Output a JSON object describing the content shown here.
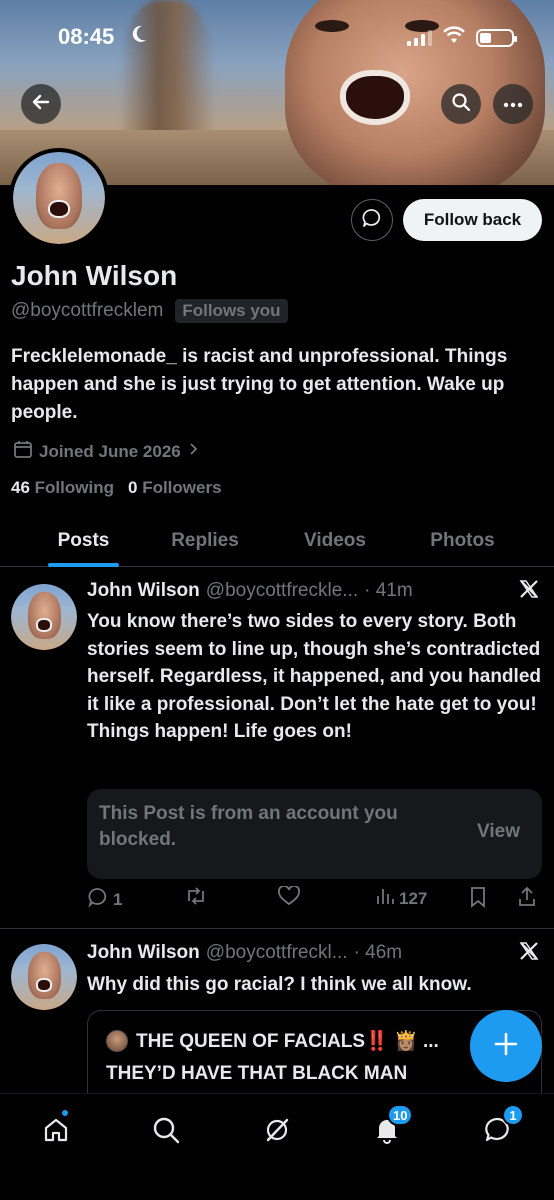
{
  "status_bar": {
    "time": "08:45"
  },
  "profile": {
    "name": "John Wilson",
    "handle": "@boycottfrecklem",
    "follows_you": "Follows you",
    "bio": "Frecklelemonade_ is racist and unprofessional. Things happen and she is just trying to get attention. Wake up people.",
    "joined": "Joined June 2026",
    "following_count": "46",
    "following_label": "Following",
    "followers_count": "0",
    "followers_label": "Followers",
    "follow_button": "Follow back"
  },
  "tabs": [
    {
      "label": "Posts",
      "active": true
    },
    {
      "label": "Replies"
    },
    {
      "label": "Videos"
    },
    {
      "label": "Photos"
    }
  ],
  "posts": [
    {
      "author": "John Wilson",
      "handle": "@boycottfreckle...",
      "time": "· 41m",
      "text": "You know there’s two sides to every story. Both stories seem to line up, though she’s contradicted herself. Regardless, it happened, and you handled it like a professional. Don’t let the hate get to you! Things happen! Life goes on!",
      "blocked_notice": "This Post is from an account you blocked.",
      "view_label": "View",
      "replies": "1",
      "views": "127"
    },
    {
      "author": "John Wilson",
      "handle": "@boycottfreckl...",
      "time": "· 46m",
      "text": "Why did this go racial? I think we all know.",
      "quote_author": "THE QUEEN OF FACIALS‼️ 👸🏽 ...",
      "quote_text": "THEY’D HAVE THAT BLACK MAN"
    }
  ],
  "nav": {
    "notifications_badge": "10",
    "messages_badge": "1"
  },
  "colors": {
    "accent": "#1d9bf0",
    "background": "#000000",
    "secondary_text": "#71767b"
  }
}
